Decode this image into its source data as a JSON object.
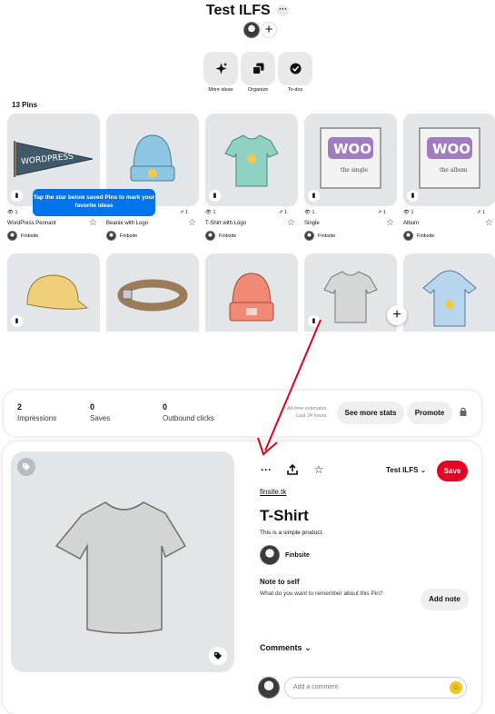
{
  "board": {
    "title": "Test ILFS",
    "more_glyph": "···",
    "add_glyph": "+",
    "actions": [
      {
        "label": "More ideas",
        "icon": "sparkle-icon"
      },
      {
        "label": "Organize",
        "icon": "organize-icon"
      },
      {
        "label": "To-dos",
        "icon": "check-circle-icon"
      }
    ],
    "pin_count": "13 Pins"
  },
  "tooltip": "Tap the star below saved Pins to mark your favorite ideas",
  "pins_row1": [
    {
      "title": "WordPress Pennant",
      "views": "1",
      "saves": "",
      "owner": "Finbsite"
    },
    {
      "title": "Beanie with Logo",
      "views": "",
      "saves": "1",
      "owner": "Finbsite"
    },
    {
      "title": "T-Shirt with Logo",
      "views": "1",
      "saves": "1",
      "owner": "Finbsite"
    },
    {
      "title": "Single",
      "views": "1",
      "saves": "1",
      "owner": "Finbsite"
    },
    {
      "title": "Album",
      "views": "1",
      "saves": "1",
      "owner": "Finbsite"
    }
  ],
  "stats": {
    "impressions": {
      "value": "2",
      "label": "Impressions"
    },
    "saves": {
      "value": "0",
      "label": "Saves"
    },
    "outbound": {
      "value": "0",
      "label": "Outbound clicks"
    },
    "estimate_line1": "All-time estimates.",
    "estimate_line2": "Last 24 hours.",
    "see_more": "See more stats",
    "promote": "Promote"
  },
  "detail": {
    "board_select": "Test ILFS",
    "save": "Save",
    "link": "finsite.tk",
    "title": "T-Shirt",
    "description": "This is a simple product.",
    "owner": "Finbsite",
    "note_heading": "Note to self",
    "note_prompt": "What do you want to remember about this Pin?",
    "add_note": "Add note",
    "comments_label": "Comments",
    "comment_placeholder": "Add a comment"
  },
  "colors": {
    "save_red": "#e60023",
    "tooltip_blue": "#0074e8",
    "annotation_arrow": "#e3001b"
  }
}
